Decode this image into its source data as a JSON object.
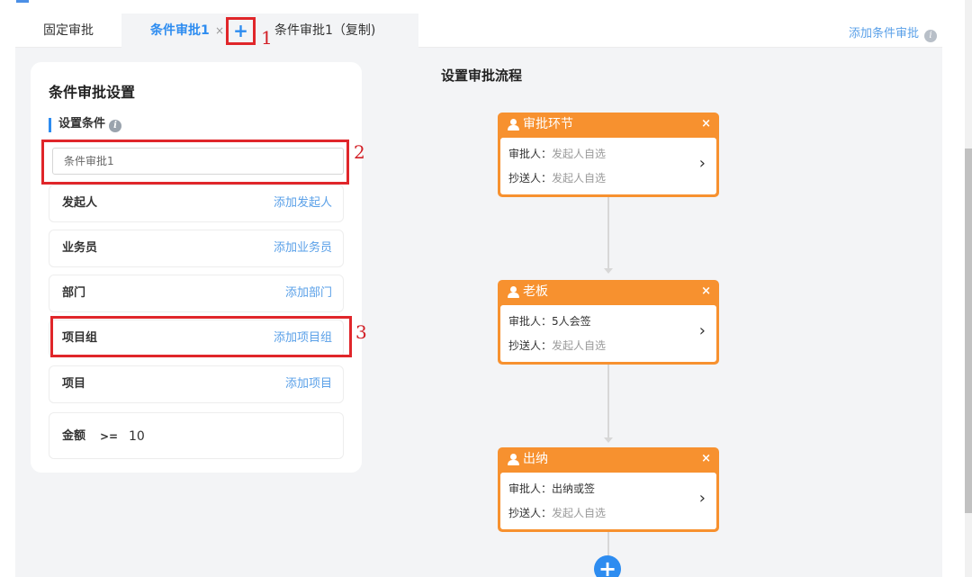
{
  "tabs": {
    "fixed": "固定审批",
    "active": "条件审批1",
    "active_close": "×",
    "add": "+",
    "copy": "条件审批1（复制)"
  },
  "header_action": {
    "label": "添加条件审批",
    "info_icon": "i"
  },
  "annotations": {
    "one": "1",
    "two": "2",
    "three": "3"
  },
  "settings": {
    "title": "条件审批设置",
    "section": "设置条件",
    "info_icon": "i",
    "condition_name": "条件审批1",
    "rows": [
      {
        "label": "发起人",
        "action": "添加发起人"
      },
      {
        "label": "业务员",
        "action": "添加业务员"
      },
      {
        "label": "部门",
        "action": "添加部门"
      },
      {
        "label": "项目组",
        "action": "添加项目组"
      },
      {
        "label": "项目",
        "action": "添加项目"
      }
    ],
    "amount": {
      "label": "金额",
      "operator": ">=",
      "value": "10"
    }
  },
  "flow": {
    "title": "设置审批流程",
    "nodes": [
      {
        "title": "审批环节",
        "approver_label": "审批人：",
        "approver": "发起人自选",
        "approver_muted": true,
        "cc_label": "抄送人：",
        "cc": "发起人自选"
      },
      {
        "title": "老板",
        "approver_label": "审批人：",
        "approver": "5人会签",
        "approver_muted": false,
        "cc_label": "抄送人：",
        "cc": "发起人自选"
      },
      {
        "title": "出纳",
        "approver_label": "审批人：",
        "approver": "出纳或签",
        "approver_muted": false,
        "cc_label": "抄送人：",
        "cc": "发起人自选"
      }
    ],
    "close": "×",
    "arrow": "›",
    "add": "+"
  },
  "colors": {
    "accent": "#2d8cf0",
    "node": "#f7912f",
    "annotation": "#e0262a"
  }
}
